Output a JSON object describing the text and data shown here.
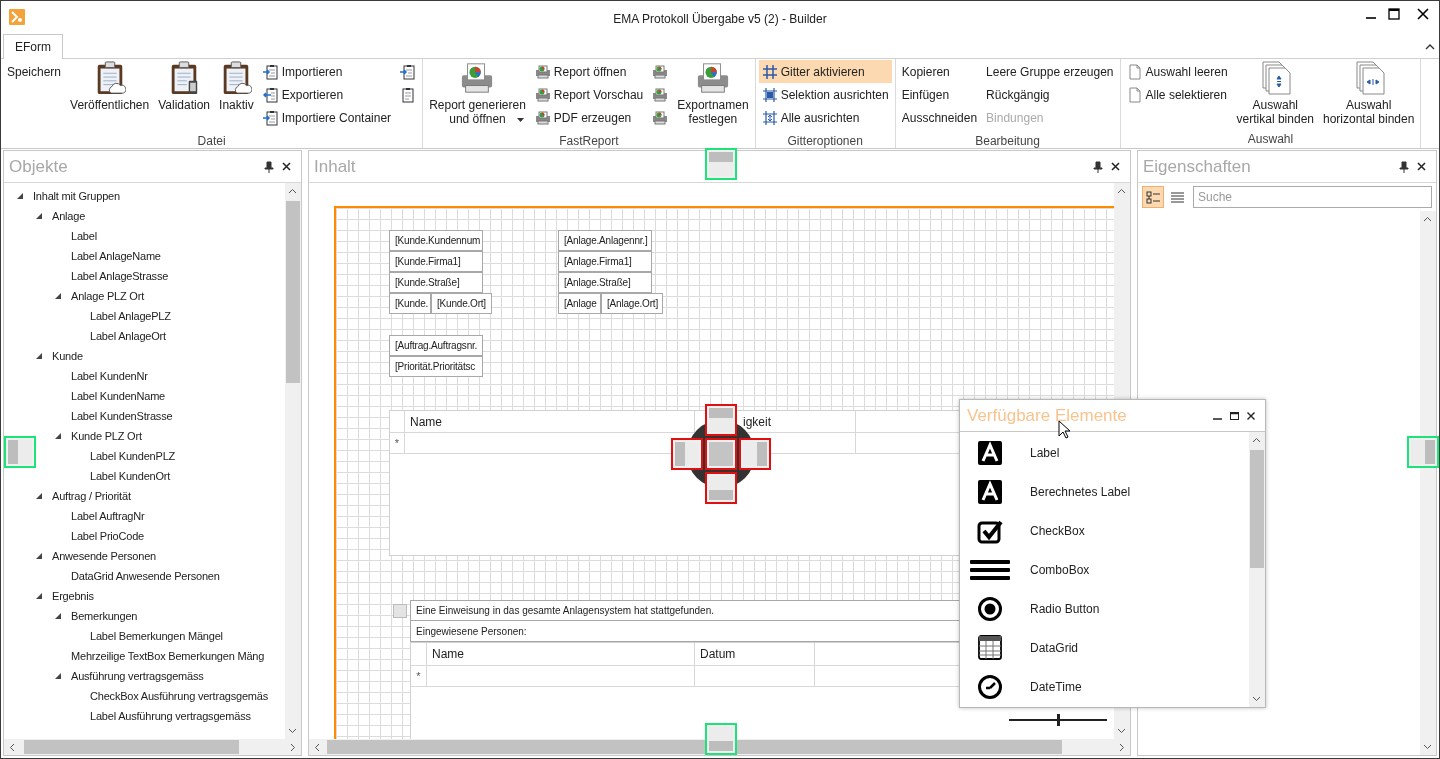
{
  "window": {
    "title": "EMA Protokoll Übergabe v5 (2) - Builder"
  },
  "ribbon": {
    "tabs": [
      {
        "label": "EForm",
        "selected": true
      }
    ],
    "groups": [
      {
        "label": "Datei",
        "columns": [
          {
            "items": [
              {
                "kind": "text",
                "label": "Speichern",
                "selected": false,
                "disabled": false
              }
            ]
          },
          {
            "items": [
              {
                "kind": "large",
                "label": "Veröffentlichen",
                "selected": false,
                "disabled": false,
                "dropdown": false
              }
            ]
          },
          {
            "items": [
              {
                "kind": "large",
                "label": "Validation",
                "selected": false,
                "disabled": false,
                "dropdown": false
              }
            ]
          },
          {
            "items": [
              {
                "kind": "large",
                "label": "Inaktiv",
                "selected": false,
                "disabled": false,
                "dropdown": false
              }
            ]
          },
          {
            "items": [
              {
                "kind": "small",
                "label": "Importieren",
                "selected": false,
                "disabled": false
              },
              {
                "kind": "small",
                "label": "Exportieren",
                "selected": false,
                "disabled": false
              },
              {
                "kind": "small",
                "label": "Importiere Container",
                "selected": false,
                "disabled": false
              }
            ]
          },
          {
            "items": [
              {
                "kind": "icon",
                "selected": false,
                "disabled": false
              },
              {
                "kind": "icon",
                "selected": false,
                "disabled": false
              }
            ]
          }
        ]
      },
      {
        "label": "FastReport",
        "columns": [
          {
            "items": [
              {
                "kind": "large",
                "label": "Report generieren\nund öffnen",
                "selected": false,
                "disabled": false,
                "dropdown": true
              }
            ]
          },
          {
            "items": [
              {
                "kind": "small",
                "label": "Report öffnen",
                "selected": false,
                "disabled": false
              },
              {
                "kind": "small",
                "label": "Report Vorschau",
                "selected": false,
                "disabled": false
              },
              {
                "kind": "small",
                "label": "PDF erzeugen",
                "selected": false,
                "disabled": false
              }
            ]
          },
          {
            "items": [
              {
                "kind": "icon",
                "selected": false,
                "disabled": false
              },
              {
                "kind": "icon",
                "selected": false,
                "disabled": false
              },
              {
                "kind": "icon",
                "selected": false,
                "disabled": false
              }
            ]
          },
          {
            "items": [
              {
                "kind": "large",
                "label": "Exportnamen\nfestlegen",
                "selected": false,
                "disabled": false,
                "dropdown": false
              }
            ]
          }
        ]
      },
      {
        "label": "Gitteroptionen",
        "columns": [
          {
            "items": [
              {
                "kind": "small",
                "label": "Gitter aktivieren",
                "selected": true,
                "disabled": false
              },
              {
                "kind": "small",
                "label": "Selektion ausrichten",
                "selected": false,
                "disabled": false
              },
              {
                "kind": "small",
                "label": "Alle ausrichten",
                "selected": false,
                "disabled": false
              }
            ]
          }
        ]
      },
      {
        "label": "Bearbeitung",
        "columns": [
          {
            "items": [
              {
                "kind": "text",
                "label": "Kopieren",
                "selected": false,
                "disabled": false
              },
              {
                "kind": "text",
                "label": "Einfügen",
                "selected": false,
                "disabled": false
              },
              {
                "kind": "text",
                "label": "Ausschneiden",
                "selected": false,
                "disabled": false
              }
            ]
          },
          {
            "items": [
              {
                "kind": "text",
                "label": "Leere Gruppe erzeugen",
                "selected": false,
                "disabled": false
              },
              {
                "kind": "text",
                "label": "Rückgängig",
                "selected": false,
                "disabled": false
              },
              {
                "kind": "text",
                "label": "Bindungen",
                "selected": false,
                "disabled": true
              }
            ]
          }
        ]
      },
      {
        "label": "Auswahl",
        "columns": [
          {
            "items": [
              {
                "kind": "small",
                "label": "Auswahl leeren",
                "selected": false,
                "disabled": false
              },
              {
                "kind": "small",
                "label": "Alle selektieren",
                "selected": false,
                "disabled": false
              }
            ]
          },
          {
            "items": [
              {
                "kind": "large",
                "label": "Auswahl\nvertikal binden",
                "selected": false,
                "disabled": false,
                "dropdown": false
              }
            ]
          },
          {
            "items": [
              {
                "kind": "large",
                "label": "Auswahl\nhorizontal binden",
                "selected": false,
                "disabled": false,
                "dropdown": false
              }
            ]
          }
        ]
      }
    ]
  },
  "objects": {
    "title": "Objekte",
    "tree": [
      {
        "label": "Inhalt mit Gruppen",
        "expanded": true,
        "children": [
          {
            "label": "Anlage",
            "expanded": true,
            "children": [
              {
                "label": "Label"
              },
              {
                "label": "Label AnlageName"
              },
              {
                "label": "Label AnlageStrasse"
              },
              {
                "label": "Anlage PLZ Ort",
                "expanded": true,
                "children": [
                  {
                    "label": "Label AnlagePLZ"
                  },
                  {
                    "label": "Label AnlageOrt"
                  }
                ]
              }
            ]
          },
          {
            "label": "Kunde",
            "expanded": true,
            "children": [
              {
                "label": "Label KundenNr"
              },
              {
                "label": "Label KundenName"
              },
              {
                "label": "Label KundenStrasse"
              },
              {
                "label": "Kunde PLZ Ort",
                "expanded": true,
                "children": [
                  {
                    "label": "Label KundenPLZ"
                  },
                  {
                    "label": "Label KundenOrt"
                  }
                ]
              }
            ]
          },
          {
            "label": "Auftrag / Priorität",
            "expanded": true,
            "children": [
              {
                "label": "Label AuftragNr"
              },
              {
                "label": "Label PrioCode"
              }
            ]
          },
          {
            "label": "Anwesende Personen",
            "expanded": true,
            "children": [
              {
                "label": "DataGrid Anwesende Personen"
              }
            ]
          },
          {
            "label": "Ergebnis",
            "expanded": true,
            "children": [
              {
                "label": "Bemerkungen",
                "expanded": true,
                "children": [
                  {
                    "label": "Label Bemerkungen Mängel"
                  }
                ]
              },
              {
                "label": "Mehrzeilige TextBox Bemerkungen Mäng"
              },
              {
                "label": "Ausführung vertragsgemäss",
                "expanded": true,
                "children": [
                  {
                    "label": "CheckBox Ausführung vertragsgemäs"
                  },
                  {
                    "label": "Label Ausführung vertragsgemäss"
                  }
                ]
              }
            ]
          }
        ]
      }
    ]
  },
  "content": {
    "title": "Inhalt",
    "fields": [
      "[Kunde.Kundennum",
      "[Kunde.Firma1]",
      "[Kunde.Straße]",
      "[Kunde.",
      "[Kunde.Ort]",
      "[Anlage.Anlagennr.]",
      "[Anlage.Firma1]",
      "[Anlage.Straße]",
      "[Anlage",
      "[Anlage.Ort]",
      "[Auftrag.Auftragsnr.",
      "[Priorität.Prioritätsc"
    ],
    "grid_1": {
      "columns": [
        "Name",
        "igkeit"
      ],
      "new_row_marker": "*"
    },
    "checkbox": {
      "checked": false,
      "label": "Eine Einweisung in das gesamte Anlagensystem hat stattgefunden."
    },
    "text": "Eingewiesene Personen:",
    "grid_2": {
      "columns": [
        "Name",
        "Datum"
      ],
      "new_row_marker": "*"
    },
    "zoom": {
      "level": 0.5
    }
  },
  "elements_window": {
    "title": "Verfügbare Elemente",
    "items": [
      {
        "label": "Label",
        "kind": "label"
      },
      {
        "label": "Berechnetes Label",
        "kind": "label"
      },
      {
        "label": "CheckBox",
        "kind": "checkbox"
      },
      {
        "label": "ComboBox",
        "kind": "combobox"
      },
      {
        "label": "Radio Button",
        "kind": "radio"
      },
      {
        "label": "DataGrid",
        "kind": "datagrid"
      },
      {
        "label": "DateTime",
        "kind": "datetime"
      }
    ]
  },
  "properties": {
    "title": "Eigenschaften",
    "view_buttons": [
      {
        "kind": "categorized",
        "selected": true
      },
      {
        "kind": "alphabetical",
        "selected": false
      }
    ],
    "search": {
      "placeholder": "Suche"
    }
  }
}
